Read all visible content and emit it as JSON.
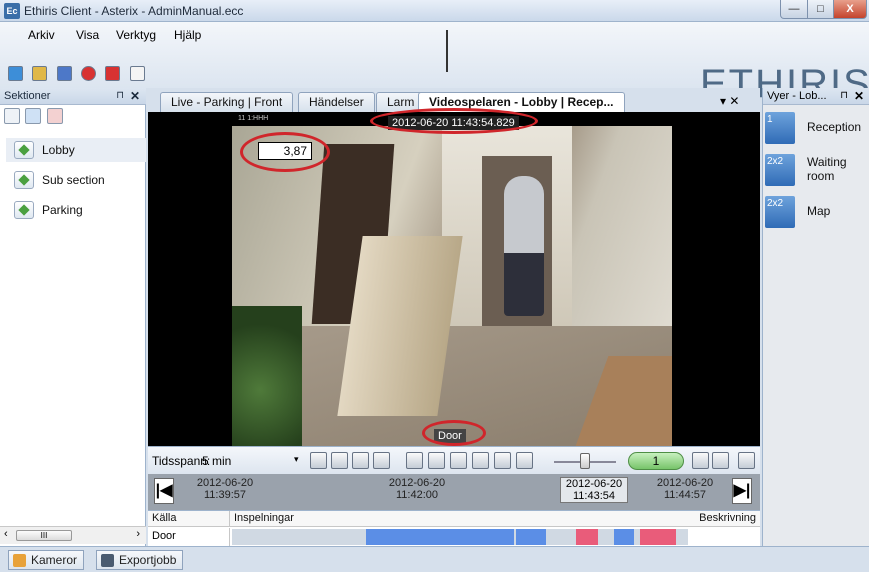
{
  "window": {
    "title": "Ethiris Client - Asterix - AdminManual.ecc",
    "app_icon_text": "Ec",
    "minimize": "—",
    "maximize": "□",
    "close": "X"
  },
  "menu": {
    "items": [
      "Arkiv",
      "Visa",
      "Verktyg",
      "Hjälp"
    ]
  },
  "logo": "ETHIRIS",
  "left_panel": {
    "title": "Sektioner",
    "pin": "⊓",
    "close": "✕",
    "sections": [
      "Lobby",
      "Sub section",
      "Parking"
    ],
    "scroll_thumb": "III",
    "scroll_left": "‹",
    "scroll_right": "›"
  },
  "tabs": {
    "items": [
      "Live - Parking | Front",
      "Händelser",
      "Larm",
      "Videospelaren - Lobby | Recep..."
    ],
    "menu_glyph": "▾ ✕"
  },
  "video": {
    "timestamp": "2012-06-20 11:43:54.829",
    "counter": "3,87",
    "label": "Door",
    "cam_tag": "11 1:HHH"
  },
  "controls": {
    "tidsspann_label": "Tidsspann:",
    "tidsspann_value": "5 min",
    "dropdown": "▾",
    "speed": "1"
  },
  "timeline": {
    "ticks": [
      {
        "date": "2012-06-20",
        "time": "11:39:57"
      },
      {
        "date": "2012-06-20",
        "time": "11:42:00"
      },
      {
        "date": "2012-06-20",
        "time": "11:44:57"
      }
    ],
    "current": {
      "date": "2012-06-20",
      "time": "11:43:54"
    },
    "prev": "|◀",
    "next": "▶|"
  },
  "recordings": {
    "col_source": "Källa",
    "col_recordings": "Inspelningar",
    "col_description": "Beskrivning",
    "source": "Door",
    "colors": {
      "recording": "#5b8ee6",
      "event": "#e95c7a",
      "idle": "#d0d9e3"
    }
  },
  "right_panel": {
    "title": "Vyer - Lob...",
    "views": [
      {
        "tile": "1",
        "label": "Reception"
      },
      {
        "tile": "2x2",
        "label": "Waiting room"
      },
      {
        "tile": "2x2",
        "label": "Map"
      }
    ]
  },
  "bottom_tabs": [
    "Kameror",
    "Exportjobb"
  ]
}
